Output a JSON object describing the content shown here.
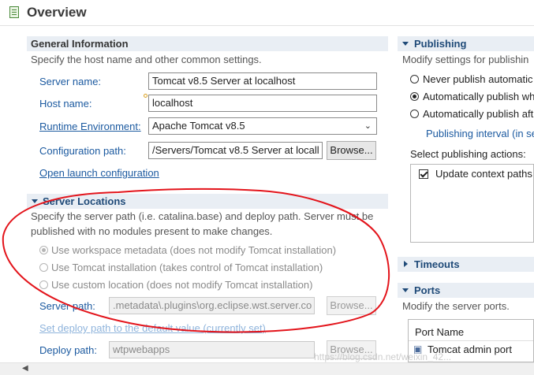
{
  "page": {
    "title": "Overview"
  },
  "general": {
    "heading": "General Information",
    "description": "Specify the host name and other common settings.",
    "server_name_label": "Server name:",
    "server_name_value": "Tomcat v8.5 Server at localhost",
    "host_name_label": "Host name:",
    "host_name_value": "localhost",
    "runtime_label": "Runtime Environment:",
    "runtime_value": "Apache Tomcat v8.5",
    "config_label": "Configuration path:",
    "config_value": "/Servers/Tomcat v8.5 Server at locall",
    "browse_label": "Browse...",
    "open_launch_label": "Open launch configuration"
  },
  "locations": {
    "heading": "Server Locations",
    "description_line1": "Specify the server path (i.e. catalina.base) and deploy path. Server must be",
    "description_line2": "published with no modules present to make changes.",
    "options": [
      "Use workspace metadata (does not modify Tomcat installation)",
      "Use Tomcat installation (takes control of Tomcat installation)",
      "Use custom location (does not modify Tomcat installation)"
    ],
    "selected_option": 0,
    "server_path_label": "Server path:",
    "server_path_value": ".metadata\\.plugins\\org.eclipse.wst.server.co",
    "browse_label": "Browse...",
    "set_deploy_label": "Set deploy path to the default value (currently set)",
    "deploy_path_label": "Deploy path:",
    "deploy_path_value": "wtpwebapps",
    "deploy_browse_label": "Browse..."
  },
  "publishing": {
    "heading": "Publishing",
    "description": "Modify settings for publishin",
    "options": [
      "Never publish automatic",
      "Automatically publish wh",
      "Automatically publish aft"
    ],
    "selected_option": 1,
    "interval_label": "Publishing interval (in se",
    "actions_label": "Select publishing actions:",
    "action_item": "Update context paths",
    "action_checked": true
  },
  "timeouts": {
    "heading": "Timeouts"
  },
  "ports": {
    "heading": "Ports",
    "description": "Modify the server ports.",
    "column_header": "Port Name",
    "row1": "Tomcat admin port"
  },
  "watermark": "https://blog.csdn.net/weixin_42..."
}
